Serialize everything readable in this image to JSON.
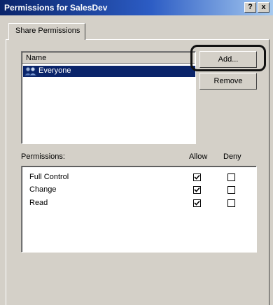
{
  "window": {
    "title": "Permissions for SalesDev",
    "help_label": "?",
    "close_label": "x"
  },
  "tab": {
    "label": "Share Permissions"
  },
  "names": {
    "column_header": "Name",
    "items": [
      {
        "label": "Everyone",
        "selected": true,
        "icon": "group-icon"
      }
    ]
  },
  "buttons": {
    "add": "Add...",
    "remove": "Remove"
  },
  "permissions": {
    "header": "Permissions:",
    "allow_header": "Allow",
    "deny_header": "Deny",
    "rows": [
      {
        "name": "Full Control",
        "allow": true,
        "deny": false
      },
      {
        "name": "Change",
        "allow": true,
        "deny": false
      },
      {
        "name": "Read",
        "allow": true,
        "deny": false
      }
    ]
  },
  "colors": {
    "title_bar": "#0a246a",
    "selection": "#0a246a",
    "dialog_face": "#d4d0c8"
  }
}
